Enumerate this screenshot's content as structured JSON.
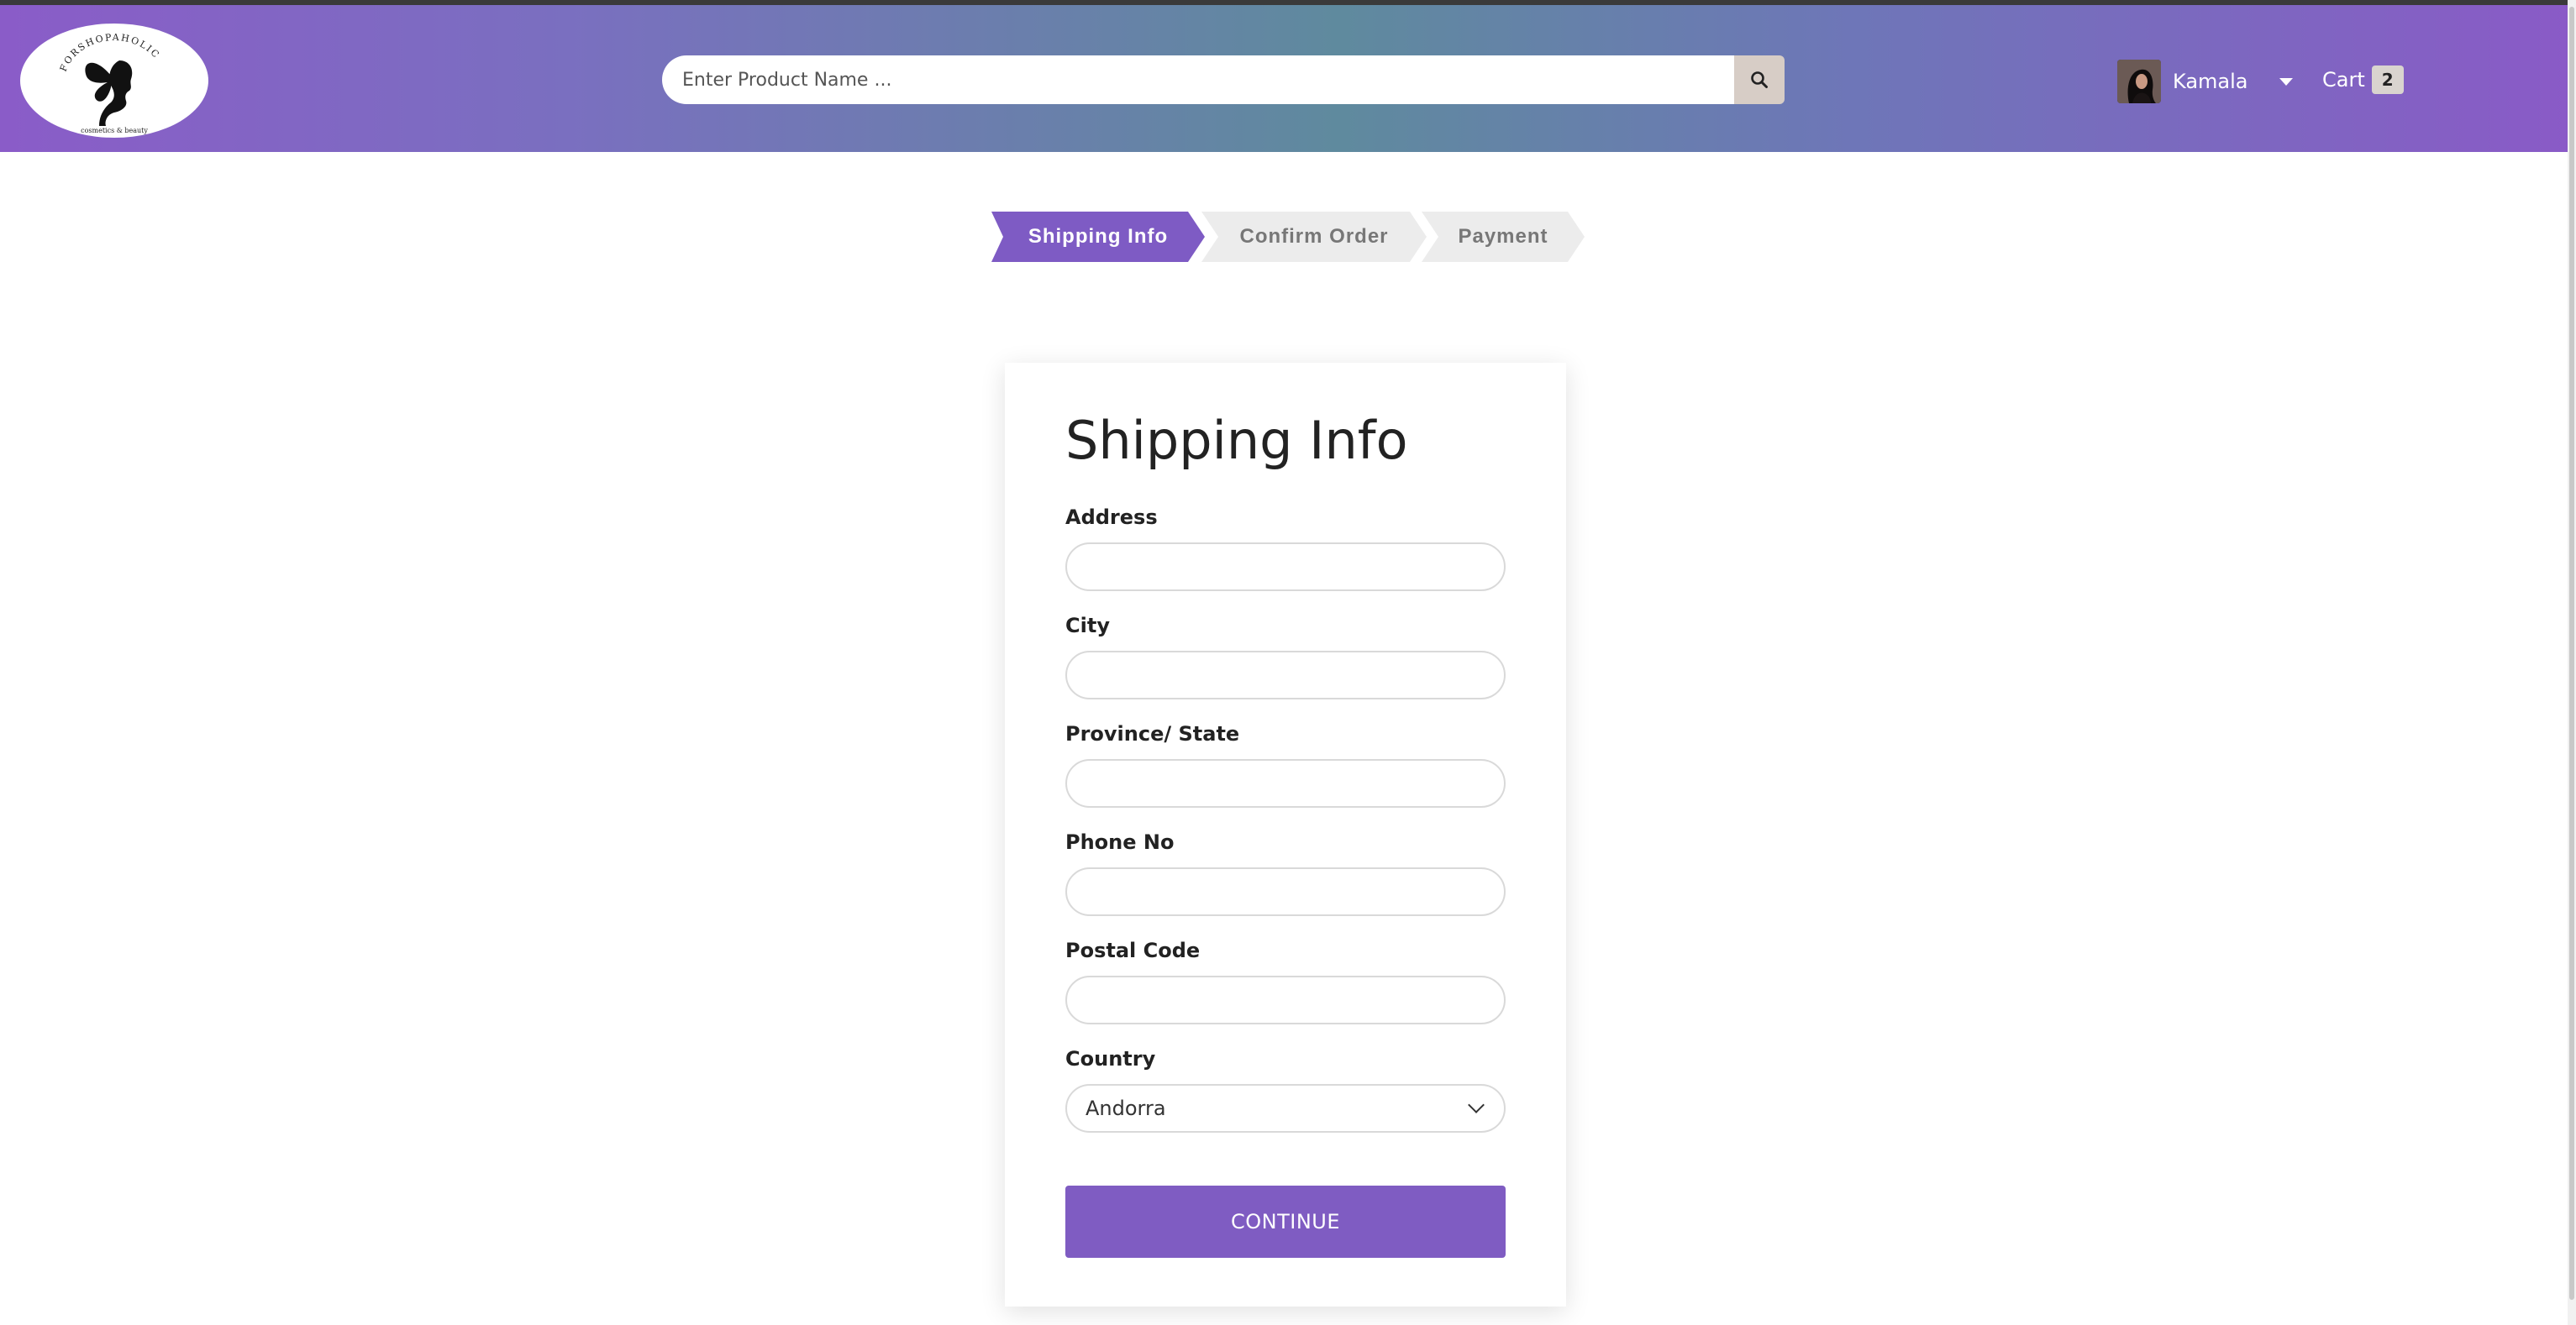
{
  "header": {
    "logo": {
      "brand_text": "FORSHOPAHOLIC",
      "tagline": "cosmetics & beauty",
      "icon": "butterfly-woman-silhouette"
    },
    "search": {
      "placeholder": "Enter Product Name ...",
      "value": "",
      "icon": "search-icon"
    },
    "user": {
      "name": "Kamala",
      "icon": "caret-down-icon"
    },
    "cart": {
      "label": "Cart",
      "count": "2"
    }
  },
  "steps": [
    {
      "label": "Shipping Info",
      "active": true
    },
    {
      "label": "Confirm Order",
      "active": false
    },
    {
      "label": "Payment",
      "active": false
    }
  ],
  "form": {
    "title": "Shipping Info",
    "fields": [
      {
        "label": "Address",
        "value": ""
      },
      {
        "label": "City",
        "value": ""
      },
      {
        "label": "Province/ State",
        "value": ""
      },
      {
        "label": "Phone No",
        "value": ""
      },
      {
        "label": "Postal Code",
        "value": ""
      }
    ],
    "country": {
      "label": "Country",
      "selected": "Andorra"
    },
    "submit_label": "CONTINUE"
  },
  "colors": {
    "accent": "#7f5cc2",
    "step_inactive": "#ececec"
  }
}
